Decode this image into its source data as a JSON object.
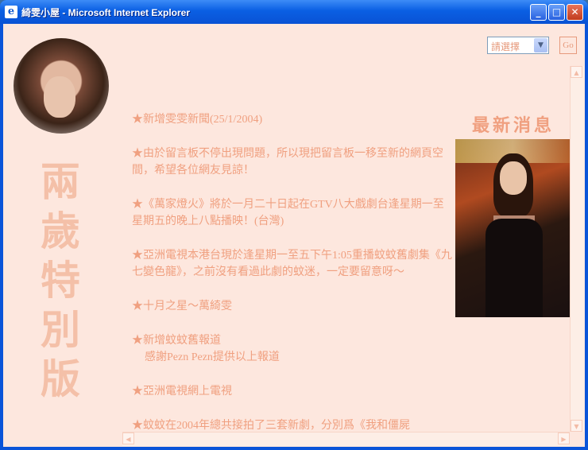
{
  "window": {
    "title": "綺雯小屋 - Microsoft Internet Explorer"
  },
  "controls": {
    "select_value": "請選擇",
    "go_label": "Go"
  },
  "sidebar": {
    "vertical_title": [
      "兩",
      "歲",
      "特",
      "別",
      "版"
    ]
  },
  "right": {
    "latest_label": "最新消息"
  },
  "news": [
    {
      "text": "★新增雯雯新聞(25/1/2004)"
    },
    {
      "text": "★由於留言板不停出現問題，所以現把留言板一移至新的網頁空間，希望各位網友見諒！"
    },
    {
      "text": "★《萬家燈火》將於一月二十日起在GTV八大戲劇台逢星期一至星期五的晚上八點播映！(台灣)"
    },
    {
      "text": "★亞洲電視本港台現於逢星期一至五下午1:05重播蚊蚊舊劇集《九七變色龍》，之前沒有看過此劇的蚊迷，一定要留意呀～"
    },
    {
      "text": "★十月之星～萬綺雯"
    },
    {
      "text": "★新增蚊蚊舊報道",
      "sub": "感謝Pezn Pezn提供以上報道"
    },
    {
      "text": "★亞洲電視網上電視"
    },
    {
      "text": "★蚊蚊在2004年總共接拍了三套新劇，分別爲《我和僵屍"
    }
  ],
  "colors": {
    "accent": "#f0a080",
    "background": "#fde7de",
    "titlebar": "#0a54d8"
  }
}
